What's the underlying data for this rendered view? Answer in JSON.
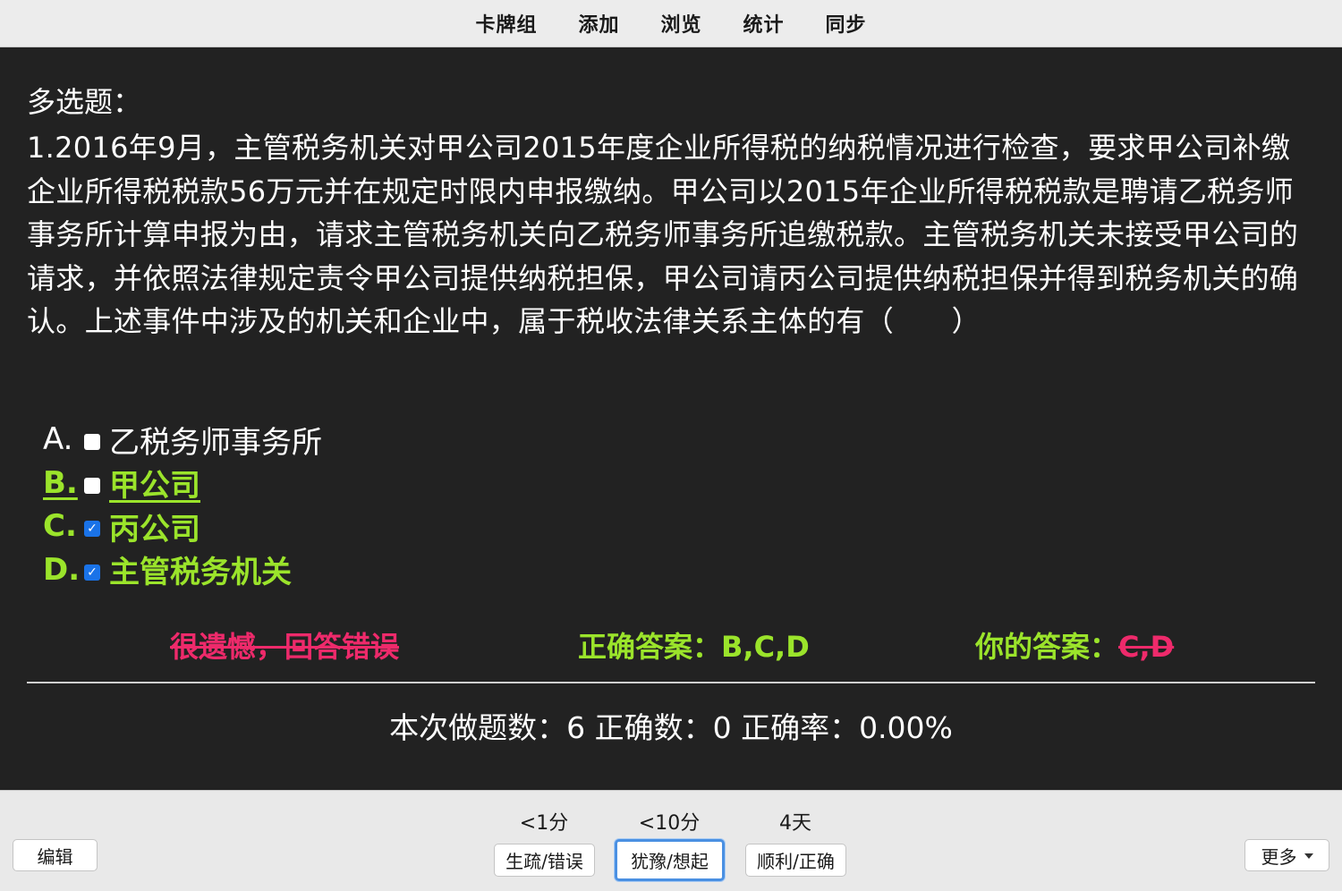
{
  "nav": {
    "items": [
      "卡牌组",
      "添加",
      "浏览",
      "统计",
      "同步"
    ]
  },
  "question": {
    "type_label": "多选题：",
    "text": "1.2016年9月，主管税务机关对甲公司2015年度企业所得税的纳税情况进行检查，要求甲公司补缴企业所得税税款56万元并在规定时限内申报缴纳。甲公司以2015年企业所得税税款是聘请乙税务师事务所计算申报为由，请求主管税务机关向乙税务师事务所追缴税款。主管税务机关未接受甲公司的请求，并依照法律规定责令甲公司提供纳税担保，甲公司请丙公司提供纳税担保并得到税务机关的确认。上述事件中涉及的机关和企业中，属于税收法律关系主体的有（　　）",
    "options": [
      {
        "letter": "A.",
        "label": "乙税务师事务所",
        "checked": false,
        "state": "normal"
      },
      {
        "letter": "B.",
        "label": "甲公司",
        "checked": false,
        "state": "missed"
      },
      {
        "letter": "C.",
        "label": "丙公司",
        "checked": true,
        "state": "correct"
      },
      {
        "letter": "D.",
        "label": "主管税务机关",
        "checked": true,
        "state": "correct"
      }
    ]
  },
  "result": {
    "verdict": "很遗憾，回答错误",
    "correct_label": "正确答案：",
    "correct_value": "B,C,D",
    "your_label": "你的答案：",
    "your_value": "C,D"
  },
  "stats": {
    "text": "本次做题数：6 正确数：0 正确率：0.00%"
  },
  "bottom": {
    "edit_label": "编辑",
    "more_label": "更多",
    "answers": [
      {
        "interval": "<1分",
        "label": "生疏/错误"
      },
      {
        "interval": "<10分",
        "label": "犹豫/想起"
      },
      {
        "interval": "4天",
        "label": "顺利/正确"
      }
    ]
  },
  "colors": {
    "correct": "#9be42b",
    "wrong": "#ee2a6b",
    "card_bg": "#222222",
    "focus": "#4a90e2"
  }
}
